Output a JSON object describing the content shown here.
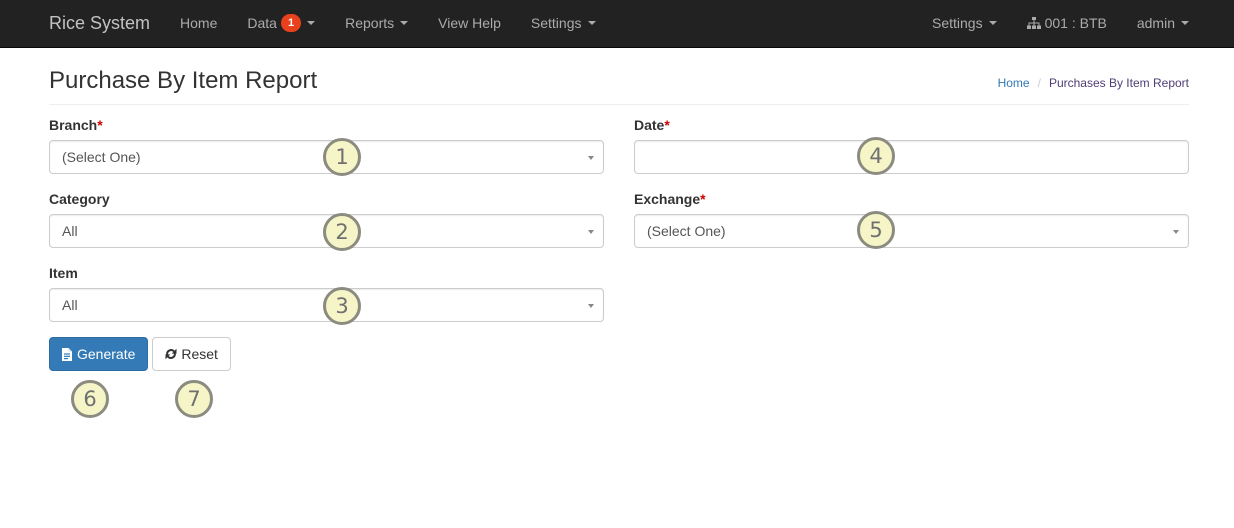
{
  "navbar": {
    "brand": "Rice System",
    "items": [
      {
        "label": "Home"
      },
      {
        "label": "Data",
        "badge": "1",
        "has_dropdown": true
      },
      {
        "label": "Reports",
        "has_dropdown": true
      },
      {
        "label": "View Help"
      },
      {
        "label": "Settings",
        "has_dropdown": true
      }
    ],
    "right_items": [
      {
        "label": "Settings",
        "has_dropdown": true
      },
      {
        "label": "001 : BTB",
        "icon": "sitemap-icon"
      },
      {
        "label": "admin",
        "has_dropdown": true
      }
    ]
  },
  "page": {
    "title": "Purchase By Item Report",
    "breadcrumb": {
      "items": [
        {
          "label": "Home"
        },
        {
          "label": "Purchases By Item Report"
        }
      ],
      "separator": "/"
    }
  },
  "form": {
    "branch": {
      "label": "Branch",
      "required_mark": "*",
      "selected": "(Select One)"
    },
    "category": {
      "label": "Category",
      "selected": "All"
    },
    "item": {
      "label": "Item",
      "selected": "All"
    },
    "date": {
      "label": "Date",
      "required_mark": "*",
      "value": ""
    },
    "exchange": {
      "label": "Exchange",
      "required_mark": "*",
      "selected": "(Select One)"
    }
  },
  "buttons": {
    "generate": {
      "label": "Generate",
      "icon": "file-text-icon"
    },
    "reset": {
      "label": "Reset",
      "icon": "refresh-icon"
    }
  },
  "annotations": [
    "1",
    "2",
    "3",
    "4",
    "5",
    "6",
    "7"
  ],
  "colors": {
    "navbar_bg": "#222222",
    "primary": "#337ab7",
    "badge": "#e8411b",
    "required": "#cc0000",
    "link": "#337ab7",
    "breadcrumb_active": "#4f3d75",
    "annotation_fill": "#f5f5c8",
    "annotation_border": "#8b8b80"
  }
}
